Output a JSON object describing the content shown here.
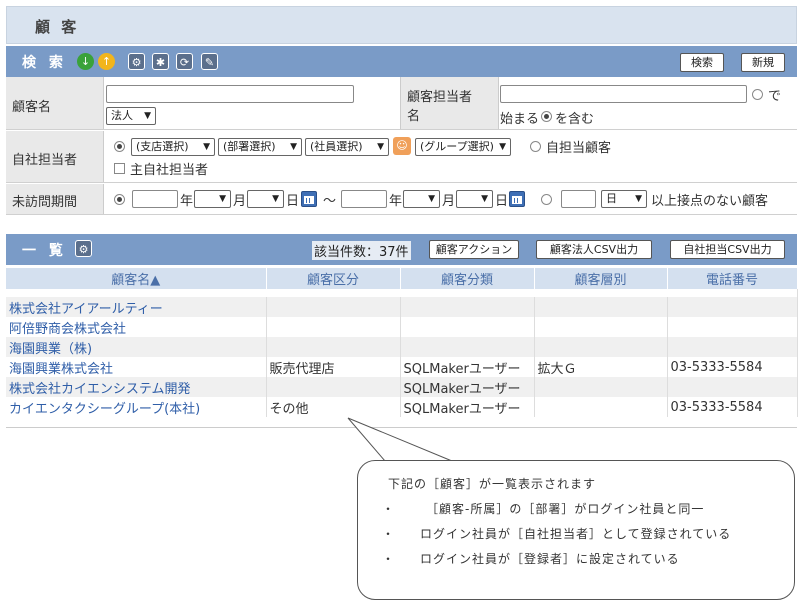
{
  "page": {
    "title": "顧 客"
  },
  "search": {
    "title": "検 索",
    "search_button": "検索",
    "new_button": "新規",
    "customer_name_label": "顧客名",
    "corp_select": "法人",
    "customer_person_label": "顧客担当者名",
    "customer_person_label_1": "顧客担当者",
    "customer_person_label_2": "名",
    "de_suffix": "で",
    "starts_with": "始まる",
    "contains": "を含む",
    "company_person_label": "自社担当者",
    "branch_select": "(支店選択)",
    "dept_select": "(部署選択)",
    "employee_select": "(社員選択)",
    "group_select": "(グループ選択)",
    "own_customers": "自担当顧客",
    "main_person": "主自社担当者",
    "unvisited_label": "未訪問期間",
    "year": "年",
    "month": "月",
    "day": "日",
    "tilde": "～",
    "unit_select": "日",
    "no_contact_suffix": "以上接点のない顧客"
  },
  "list": {
    "title": "一 覧",
    "count_label": "該当件数：37件",
    "action_button": "顧客アクション",
    "corp_csv_button": "顧客法人CSV出力",
    "staff_csv_button": "自社担当CSV出力",
    "columns": [
      "顧客名▲",
      "顧客区分",
      "顧客分類",
      "顧客層別",
      "電話番号"
    ],
    "rows": [
      [
        "株式会社アイアールティー",
        "",
        "",
        "",
        ""
      ],
      [
        "阿倍野商会株式会社",
        "",
        "",
        "",
        ""
      ],
      [
        "海園興業（株)",
        "",
        "",
        "",
        ""
      ],
      [
        "海園興業株式会社",
        "販売代理店",
        "SQLMakerユーザー",
        "拡大Ｇ",
        "03-5333-5584"
      ],
      [
        "株式会社カイエンシステム開発",
        "",
        "SQLMakerユーザー",
        "",
        ""
      ],
      [
        "カイエンタクシーグループ(本社)",
        "その他",
        "SQLMakerユーザー",
        "",
        "03-5333-5584"
      ]
    ]
  },
  "callout": {
    "line1": "下記の［顧客］が一覧表示されます",
    "line2": "［顧客-所属］の［部署］がログイン社員と同一",
    "line3": "ログイン社員が［自社担当者］として登録されている",
    "line4": "ログイン社員が［登録者］に設定されている",
    "bullet": "・"
  },
  "colors": {
    "header_bar": "#7a9bc7",
    "title_bg": "#d9e3ef",
    "link": "#2f5ea8"
  },
  "icons": [
    "arrow-down-icon",
    "arrow-up-icon",
    "gear-icon",
    "settings-icon",
    "reset-icon",
    "edit-icon",
    "person-icon",
    "calendar-icon"
  ]
}
